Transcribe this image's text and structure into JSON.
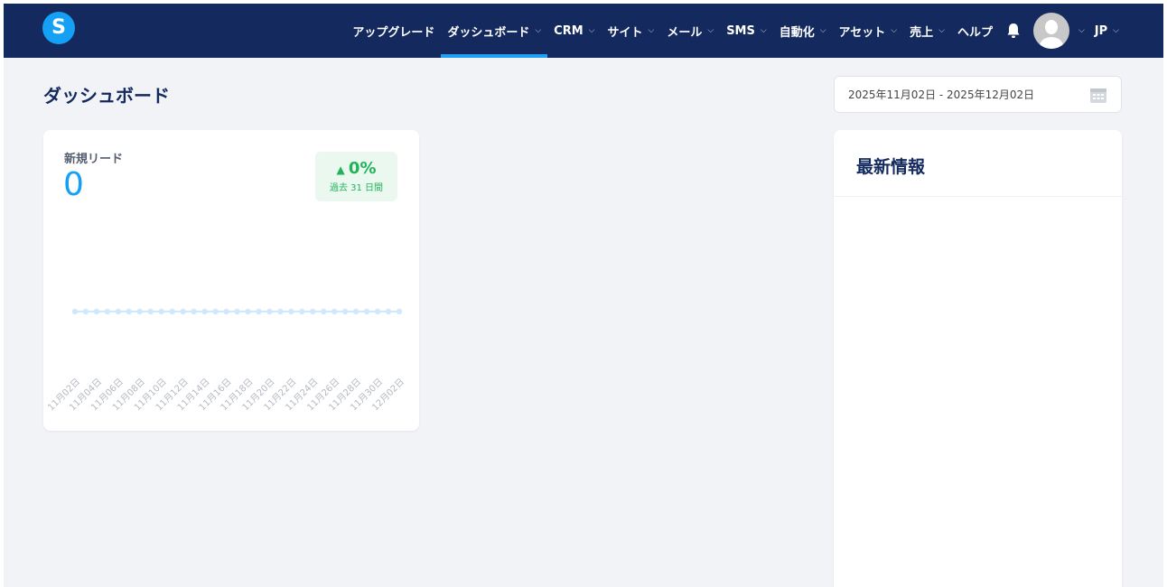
{
  "nav": {
    "logo": "S",
    "items": [
      {
        "label": "アップグレード",
        "chevron": false
      },
      {
        "label": "ダッシュボード",
        "chevron": true,
        "active": true
      },
      {
        "label": "CRM",
        "chevron": true
      },
      {
        "label": "サイト",
        "chevron": true
      },
      {
        "label": "メール",
        "chevron": true
      },
      {
        "label": "SMS",
        "chevron": true
      },
      {
        "label": "自動化",
        "chevron": true
      },
      {
        "label": "アセット",
        "chevron": true
      },
      {
        "label": "売上",
        "chevron": true
      },
      {
        "label": "ヘルプ",
        "chevron": false
      }
    ],
    "language": "JP"
  },
  "page": {
    "title": "ダッシュボード",
    "date_range": "2025年11月02日 - 2025年12月02日"
  },
  "leads": {
    "label": "新規リード",
    "value": "0",
    "change": "0%",
    "period": "過去 31 日間"
  },
  "news": {
    "title": "最新情報"
  },
  "chart_data": {
    "type": "line",
    "title": "新規リード",
    "x_labels": [
      "11月02日",
      "11月04日",
      "11月06日",
      "11月08日",
      "11月10日",
      "11月12日",
      "11月14日",
      "11月16日",
      "11月18日",
      "11月20日",
      "11月22日",
      "11月24日",
      "11月26日",
      "11月28日",
      "11月30日",
      "12月02日"
    ],
    "values": [
      0,
      0,
      0,
      0,
      0,
      0,
      0,
      0,
      0,
      0,
      0,
      0,
      0,
      0,
      0,
      0,
      0,
      0,
      0,
      0,
      0,
      0,
      0,
      0,
      0,
      0,
      0,
      0,
      0,
      0,
      0
    ],
    "color": "#cfe8fd"
  }
}
